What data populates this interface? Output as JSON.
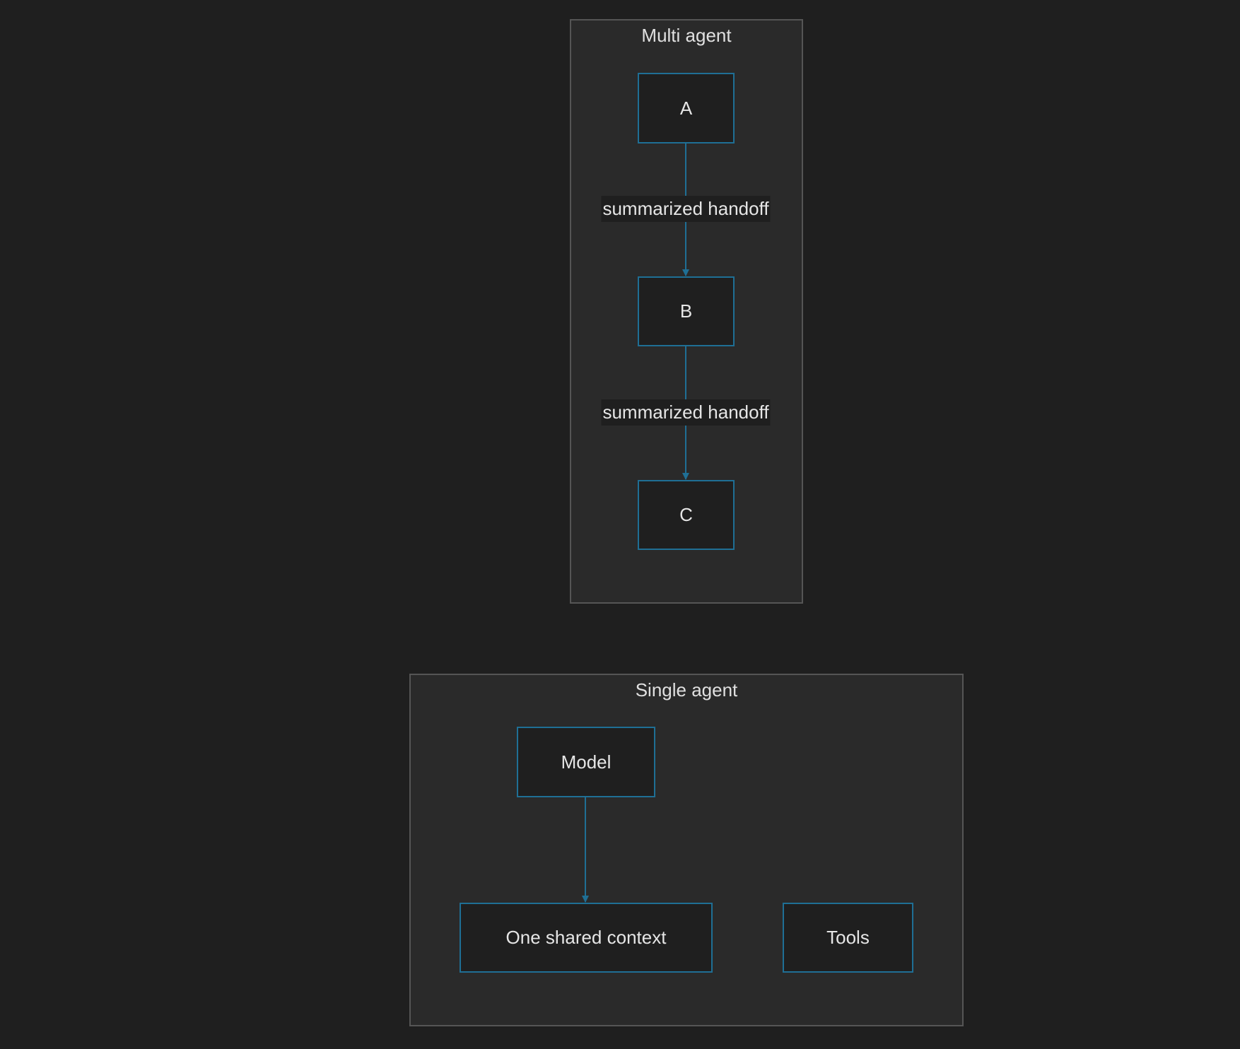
{
  "colors": {
    "background": "#1f1f1f",
    "cluster_fill": "#2a2a2a",
    "cluster_border": "#555555",
    "node_border": "#1f6f95",
    "edge": "#1f6f95",
    "text": "#e6e6e6"
  },
  "clusters": {
    "multi_agent": {
      "title": "Multi agent"
    },
    "single_agent": {
      "title": "Single agent"
    }
  },
  "nodes": {
    "a": "A",
    "b": "B",
    "c": "C",
    "model": "Model",
    "shared_context": "One shared context",
    "tools": "Tools"
  },
  "edges": [
    {
      "from": "A",
      "to": "B",
      "label": "summarized handoff"
    },
    {
      "from": "B",
      "to": "C",
      "label": "summarized handoff"
    },
    {
      "from": "Model",
      "to": "One shared context",
      "label": ""
    }
  ]
}
